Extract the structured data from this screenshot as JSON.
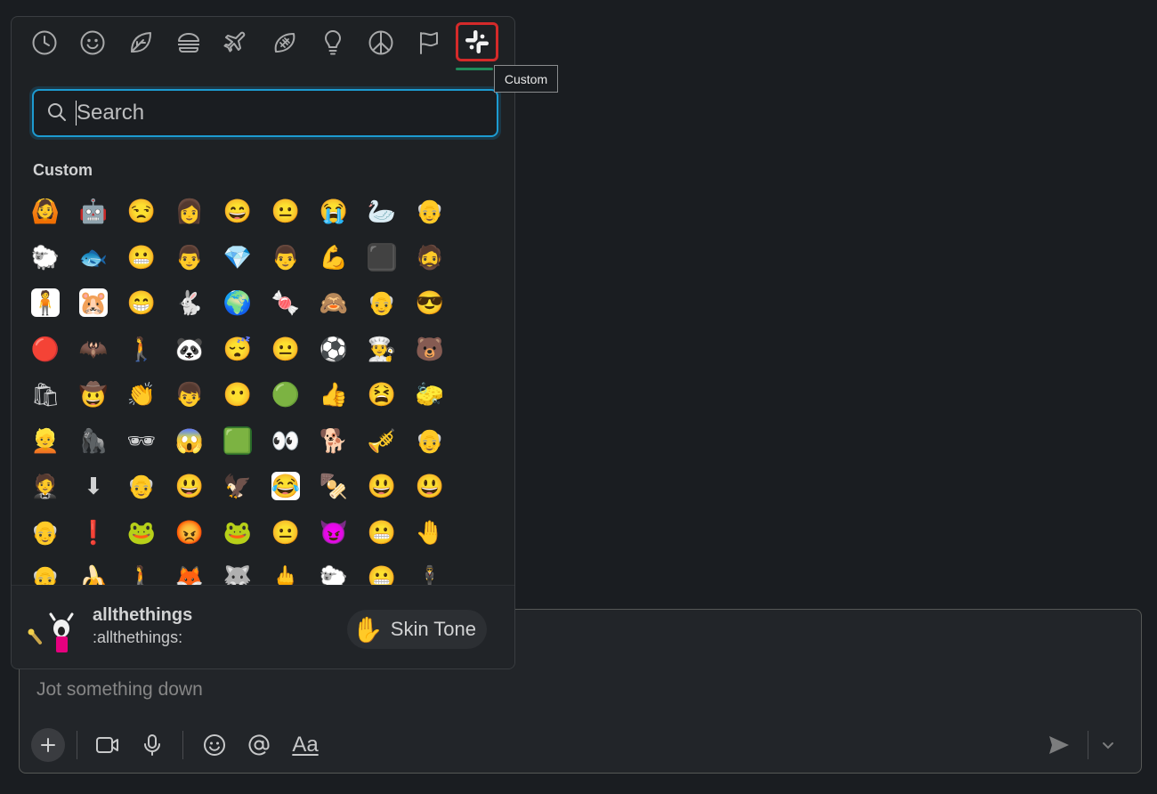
{
  "categories": [
    {
      "name": "Frequently Used",
      "icon": "clock-icon"
    },
    {
      "name": "Smileys & People",
      "icon": "smiley-icon"
    },
    {
      "name": "Nature",
      "icon": "leaf-icon"
    },
    {
      "name": "Food & Drink",
      "icon": "burger-icon"
    },
    {
      "name": "Travel & Places",
      "icon": "airplane-icon"
    },
    {
      "name": "Activities",
      "icon": "football-icon"
    },
    {
      "name": "Objects",
      "icon": "lightbulb-icon"
    },
    {
      "name": "Symbols",
      "icon": "peace-icon"
    },
    {
      "name": "Flags",
      "icon": "flag-icon"
    },
    {
      "name": "Custom",
      "icon": "slack-icon",
      "active": true
    }
  ],
  "tooltip": "Custom",
  "search": {
    "placeholder": "Search",
    "value": ""
  },
  "section_heading": "Custom",
  "emojis": [
    "🙆",
    "🤖",
    "😒",
    "👩",
    "😄",
    "😐",
    "😭",
    "🦢",
    "👴",
    "🐑",
    "🐟",
    "😬",
    "👨",
    "💎",
    "👨",
    "💪",
    "⬛",
    "🧔",
    "🧍",
    "🐹",
    "😁",
    "🐇",
    "🌍",
    "🍬",
    "🙈",
    "👴",
    "😎",
    "🔴",
    "🦇",
    "🚶",
    "🐼",
    "😴",
    "😐",
    "⚽",
    "👨‍🍳",
    "🐻",
    "🛍",
    "🤠",
    "👏",
    "👦",
    "😶",
    "🟢",
    "👍",
    "😫",
    "🧽",
    "👱",
    "🦍",
    "🕶",
    "😱",
    "🟩",
    "👀",
    "🐕",
    "🎺",
    "👴",
    "🤵",
    "⬇",
    "👴",
    "😃",
    "🦅",
    "😂",
    "🍢",
    "😃",
    "😃",
    "👴",
    "❗",
    "🐸",
    "😡",
    "🐸",
    "😐",
    "😈",
    "😬",
    "🤚",
    "👴",
    "🍌",
    "🚶",
    "🦊",
    "🐺",
    "🖕",
    "🐑",
    "😬",
    "🕴"
  ],
  "emoji_bg": [
    "#1e2124",
    "#1e2124",
    "#1e2124",
    "#1e2124",
    "#1e2124",
    "#1e2124",
    "#1e2124",
    "#1e2124",
    "#1e2124",
    "#1e2124",
    "#1e2124",
    "#1e2124",
    "#1e2124",
    "#1e2124",
    "#1e2124",
    "#1e2124",
    "#444444",
    "#1e2124",
    "#ffffff",
    "#ffffff",
    "#1e2124",
    "#1e2124",
    "#1e2124",
    "#1e2124",
    "#1e2124",
    "#1e2124",
    "#1e2124",
    "#1e2124",
    "#1e2124",
    "#1e2124",
    "#1e2124",
    "#1e2124",
    "#1e2124",
    "#1e2124",
    "#1e2124",
    "#1e2124",
    "#1e2124",
    "#1e2124",
    "#1e2124",
    "#1e2124",
    "#1e2124",
    "#1e2124",
    "#1e2124",
    "#1e2124",
    "#1e2124",
    "#1e2124",
    "#1e2124",
    "#1e2124",
    "#1e2124",
    "#2a6b2a",
    "#1e2124",
    "#1e2124",
    "#1e2124",
    "#1e2124",
    "#1e2124",
    "#1e2124",
    "#1e2124",
    "#1e2124",
    "#1e2124",
    "#ffffff",
    "#1e2124",
    "#1e2124",
    "#1e2124",
    "#1e2124",
    "#1e2124",
    "#1e2124",
    "#1e2124",
    "#1e2124",
    "#1e2124",
    "#1e2124",
    "#1e2124",
    "#1e2124",
    "#1e2124",
    "#1e2124",
    "#1e2124",
    "#1e2124",
    "#1e2124",
    "#1e2124",
    "#1e2124",
    "#1e2124",
    "#1e2124"
  ],
  "preview": {
    "emoji": "🙆",
    "name": "allthethings",
    "code": ":allthethings:"
  },
  "skin_tone": {
    "emoji": "✋",
    "label": "Skin Tone"
  },
  "composer": {
    "placeholder": "Jot something down",
    "format_label": "Aa"
  },
  "colors": {
    "background": "#1a1d21",
    "accent_blue": "#1d9bd1",
    "active_outline": "#d42a2a",
    "active_underline": "#1f8a5a"
  }
}
